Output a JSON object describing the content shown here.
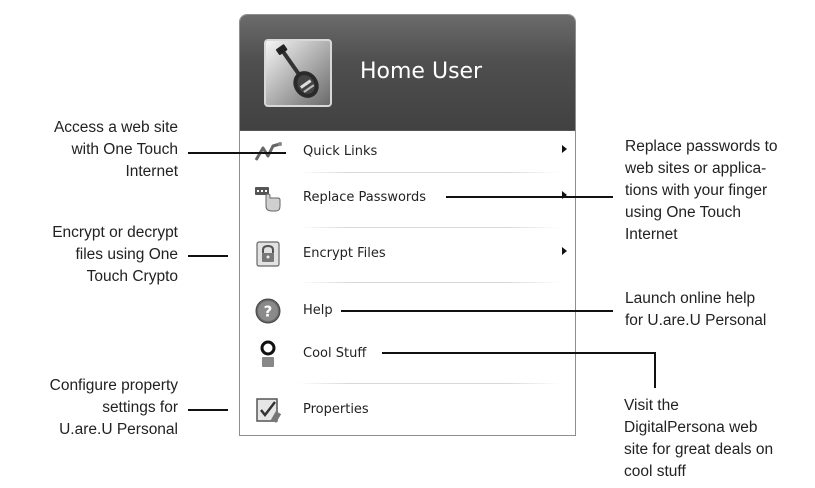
{
  "header": {
    "user_name": "Home User",
    "avatar_icon": "guitar-icon"
  },
  "menu": {
    "items": [
      {
        "label": "Quick Links",
        "icon": "quick-links-icon",
        "submenu": true
      },
      {
        "label": "Replace Passwords",
        "icon": "finger-key-icon",
        "submenu": true
      },
      {
        "label": "Encrypt Files",
        "icon": "safe-lock-icon",
        "submenu": true
      },
      {
        "label": "Help",
        "icon": "help-icon",
        "submenu": false
      },
      {
        "label": "Cool Stuff",
        "icon": "person-icon",
        "submenu": false
      },
      {
        "label": "Properties",
        "icon": "checklist-icon",
        "submenu": false
      }
    ]
  },
  "callouts": {
    "quick_links": [
      "Access a web site",
      "with One Touch",
      "Internet"
    ],
    "encrypt": [
      "Encrypt or decrypt",
      "files using One",
      "Touch Crypto"
    ],
    "properties": [
      "Configure property",
      "settings for",
      "U.are.U Personal"
    ],
    "replace": [
      "Replace passwords to",
      "web sites or applica-",
      "tions with your finger",
      "using One Touch",
      "Internet"
    ],
    "help": [
      "Launch online help",
      "for U.are.U Personal"
    ],
    "cool_stuff": [
      "Visit the",
      "DigitalPersona web",
      "site for great deals on",
      "cool stuff"
    ]
  }
}
